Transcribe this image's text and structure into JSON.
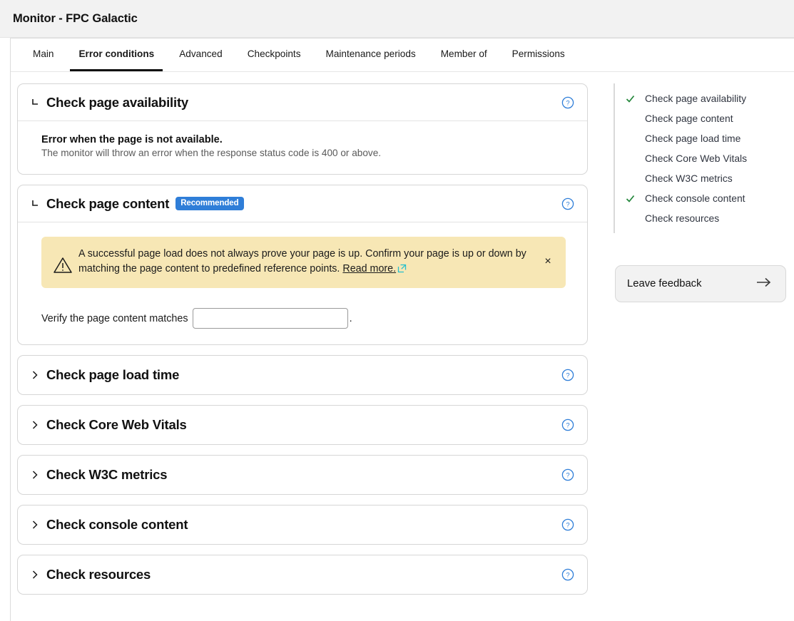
{
  "header": {
    "title": "Monitor - FPC Galactic"
  },
  "tabs": [
    {
      "label": "Main",
      "active": false
    },
    {
      "label": "Error conditions",
      "active": true
    },
    {
      "label": "Advanced",
      "active": false
    },
    {
      "label": "Checkpoints",
      "active": false
    },
    {
      "label": "Maintenance periods",
      "active": false
    },
    {
      "label": "Member of",
      "active": false
    },
    {
      "label": "Permissions",
      "active": false
    }
  ],
  "cards": {
    "availability": {
      "title": "Check page availability",
      "state": "expanded",
      "chevron_icon": "chevron-collapse-icon",
      "help_icon": "help-circle-icon",
      "body_strong": "Error when the page is not available.",
      "body_sub": "The monitor will throw an error when the response status code is 400 or above."
    },
    "content": {
      "title": "Check page content",
      "badge": "Recommended",
      "state": "expanded",
      "chevron_icon": "chevron-collapse-icon",
      "help_icon": "help-circle-icon",
      "warning": {
        "icon": "warning-triangle-icon",
        "text_part1": "A successful page load does not always prove your page is up. Confirm your page is up or down by matching the page content to predefined reference points. ",
        "link_text": "Read more.",
        "external_icon": "external-link-icon",
        "close_icon": "close-icon",
        "close_label": "×",
        "background_color": "#f7e7b5"
      },
      "verify_label": "Verify the page content matches",
      "verify_value": "",
      "verify_placeholder": "",
      "verify_suffix": "."
    },
    "collapsed": [
      {
        "title": "Check page load time",
        "chevron_icon": "chevron-right-icon",
        "help_icon": "help-circle-icon"
      },
      {
        "title": "Check Core Web Vitals",
        "chevron_icon": "chevron-right-icon",
        "help_icon": "help-circle-icon"
      },
      {
        "title": "Check W3C metrics",
        "chevron_icon": "chevron-right-icon",
        "help_icon": "help-circle-icon"
      },
      {
        "title": "Check console content",
        "chevron_icon": "chevron-right-icon",
        "help_icon": "help-circle-icon"
      },
      {
        "title": "Check resources",
        "chevron_icon": "chevron-right-icon",
        "help_icon": "help-circle-icon"
      }
    ]
  },
  "sidebar": {
    "items": [
      {
        "label": "Check page availability",
        "checked": true
      },
      {
        "label": "Check page content",
        "checked": false
      },
      {
        "label": "Check page load time",
        "checked": false
      },
      {
        "label": "Check Core Web Vitals",
        "checked": false
      },
      {
        "label": "Check W3C metrics",
        "checked": false
      },
      {
        "label": "Check console content",
        "checked": true
      },
      {
        "label": "Check resources",
        "checked": false
      }
    ],
    "feedback": {
      "label": "Leave feedback",
      "arrow_icon": "arrow-right-icon"
    }
  },
  "colors": {
    "accent_blue": "#2f7ed8",
    "check_green": "#22863a",
    "warning_bg": "#f7e7b5",
    "external_link_teal": "#26bfcc",
    "header_bg": "#f2f2f2"
  }
}
